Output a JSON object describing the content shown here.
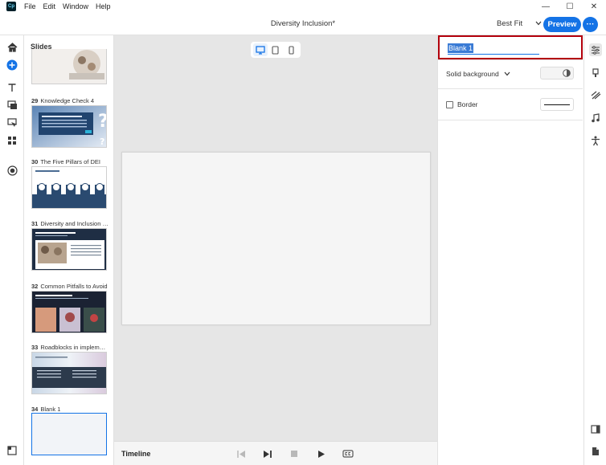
{
  "app": {
    "logo_text": "Cp",
    "menu": [
      "File",
      "Edit",
      "Window",
      "Help"
    ],
    "window_controls": [
      "—",
      "☐",
      "✕"
    ]
  },
  "header": {
    "document_title": "Diversity Inclusion*",
    "zoom_value": "Best Fit",
    "preview_label": "Preview",
    "more_label": "···"
  },
  "slides_panel": {
    "title": "Slides",
    "slides": [
      {
        "number": "",
        "title": ""
      },
      {
        "number": "29",
        "title": "Knowledge Check 4"
      },
      {
        "number": "30",
        "title": "The Five Pillars of DEI"
      },
      {
        "number": "31",
        "title": "Diversity and Inclusion Bes..."
      },
      {
        "number": "32",
        "title": "Common Pitfalls to Avoid"
      },
      {
        "number": "33",
        "title": "Roadblocks in implementin..."
      },
      {
        "number": "34",
        "title": "Blank 1"
      }
    ]
  },
  "canvas": {
    "devices": [
      "desktop",
      "tablet",
      "mobile"
    ],
    "active_device": "desktop"
  },
  "timeline": {
    "label": "Timeline"
  },
  "properties": {
    "slide_name": "Blank 1",
    "background_type": "Solid background",
    "border_label": "Border",
    "border_checked": false
  },
  "colors": {
    "accent": "#1473e6",
    "highlight_box": "#b3000c",
    "slide_dark": "#1f2e44"
  }
}
